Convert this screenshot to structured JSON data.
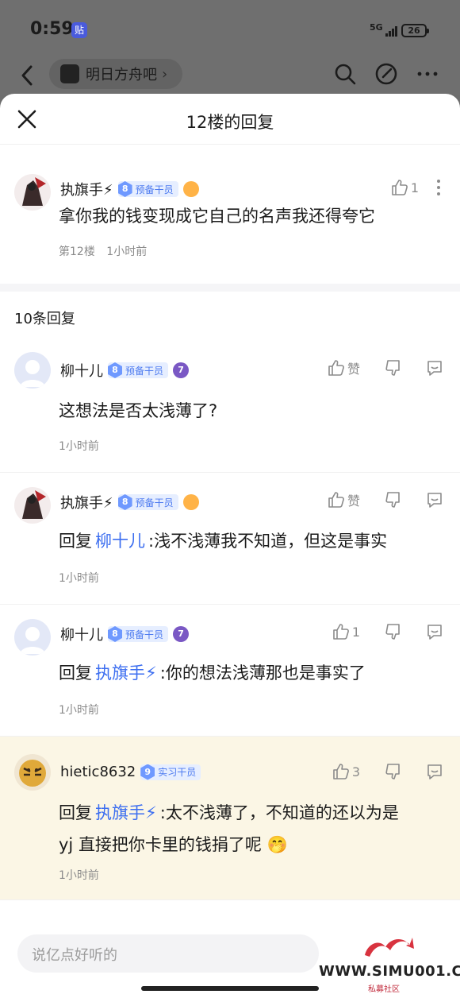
{
  "status": {
    "time": "0:59",
    "app_badge": "贴",
    "network": "5G",
    "battery": "26"
  },
  "topbar": {
    "forum_name": "明日方舟吧"
  },
  "sheet": {
    "title": "12楼的回复"
  },
  "post": {
    "user": "执旗手⚡",
    "level_num": "8",
    "level_title": "预备干员",
    "like_count": "1",
    "content": "拿你我的钱变现成它自己的名声我还得夸它",
    "floor": "第12楼",
    "time": "1小时前"
  },
  "replies_count": "10条回复",
  "comments": [
    {
      "user": "柳十儿",
      "level_num": "8",
      "level_title": "预备干员",
      "medal": "7",
      "like_label": "赞",
      "text": "这想法是否太浅薄了?",
      "time": "1小时前"
    },
    {
      "user": "执旗手⚡",
      "level_num": "8",
      "level_title": "预备干员",
      "like_label": "赞",
      "reply_prefix": "回复",
      "mention": "柳十儿",
      "text": ":浅不浅薄我不知道，但这是事实",
      "time": "1小时前"
    },
    {
      "user": "柳十儿",
      "level_num": "8",
      "level_title": "预备干员",
      "medal": "7",
      "like_label": "1",
      "reply_prefix": "回复",
      "mention": "执旗手⚡",
      "text": ":你的想法浅薄那也是事实了",
      "time": "1小时前"
    },
    {
      "user": "hietic8632",
      "level_num": "9",
      "level_title": "实习干员",
      "like_label": "3",
      "reply_prefix": "回复",
      "mention": "执旗手⚡",
      "text": ":太不浅薄了，不知道的还以为是",
      "text2": "yj 直接把你卡里的钱捐了呢 🤭",
      "time": "1小时前"
    }
  ],
  "input": {
    "placeholder": "说亿点好听的"
  },
  "watermark": {
    "text": "WWW.SIMU001.CN",
    "sub": "私募社区"
  },
  "colors": {
    "accent": "#3c6ef0",
    "level_badge": "#6f99ff",
    "highlight_bg": "#fbf6e5"
  }
}
